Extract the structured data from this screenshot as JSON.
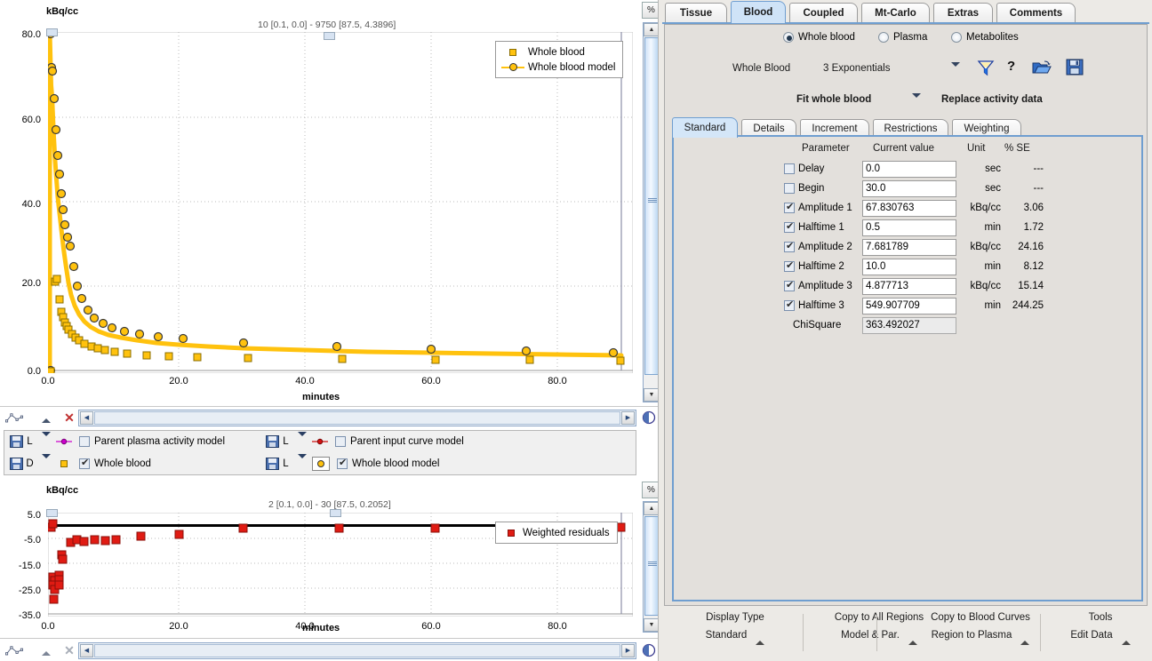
{
  "main_plot": {
    "y_unit": "kBq/cc",
    "title": "10 [0.1, 0.0] - 9750 [87.5, 4.3896]",
    "x_label": "minutes",
    "y_ticks": [
      "80.0",
      "60.0",
      "40.0",
      "20.0",
      "0.0"
    ],
    "x_ticks": [
      "0.0",
      "20.0",
      "40.0",
      "60.0",
      "80.0"
    ],
    "legend": [
      {
        "label": "Whole blood",
        "symbol": "square-marker",
        "color": "#FFC20E"
      },
      {
        "label": "Whole blood model",
        "symbol": "circle-line-marker",
        "color": "#FFC20E"
      }
    ],
    "percent_button": "%"
  },
  "resid_plot": {
    "y_unit": "kBq/cc",
    "title": "2 [0.1, 0.0] - 30 [87.5, 0.2052]",
    "x_label": "minutes",
    "y_ticks": [
      "5.0",
      "-5.0",
      "-15.0",
      "-25.0",
      "-35.0"
    ],
    "x_ticks": [
      "0.0",
      "20.0",
      "40.0",
      "60.0",
      "80.0"
    ],
    "legend": [
      {
        "label": "Weighted residuals",
        "symbol": "square-marker",
        "color": "#E01B13"
      }
    ],
    "percent_button": "%"
  },
  "chart_data": [
    {
      "type": "scatter",
      "id": "whole-blood-activity",
      "title": "10 [0.1, 0.0] - 9750 [87.5, 4.3896]",
      "xlabel": "minutes",
      "ylabel": "kBq/cc",
      "xlim": [
        0,
        91
      ],
      "ylim": [
        0,
        82
      ],
      "grid": true,
      "legend_position": "top-right",
      "series": [
        {
          "name": "Whole blood",
          "marker": "square",
          "color": "#FFC20E",
          "x": [
            0.1,
            0.35,
            0.6,
            0.85,
            1.1,
            1.35,
            1.6,
            1.85,
            2.1,
            2.6,
            3.1,
            3.6,
            4.5,
            5.5,
            6.5,
            7.5,
            9.0,
            11.0,
            14.0,
            17.5,
            22.0,
            30.0,
            45.0,
            60.0,
            75.0,
            87.5
          ],
          "y": [
            0.0,
            22.3,
            22.7,
            17.8,
            15.0,
            13.7,
            12.5,
            11.6,
            10.8,
            9.8,
            9.0,
            8.3,
            7.6,
            7.0,
            6.6,
            6.2,
            5.8,
            5.4,
            5.1,
            4.9,
            4.7,
            4.6,
            4.5,
            4.4,
            4.4,
            4.3896
          ]
        },
        {
          "name": "Whole blood model",
          "marker": "circle-line",
          "color": "#FFC20E",
          "x": [
            0.1,
            0.3,
            0.5,
            0.7,
            0.9,
            1.1,
            1.3,
            1.5,
            1.7,
            1.9,
            2.1,
            2.4,
            2.7,
            3.1,
            3.6,
            4.2,
            5.0,
            6.0,
            7.2,
            8.6,
            10.5,
            13.0,
            16.0,
            20.0,
            30.0,
            45.0,
            60.0,
            75.0,
            87.5
          ],
          "y": [
            0.0,
            80.0,
            72.0,
            71.5,
            64.5,
            57.0,
            51.0,
            46.5,
            42.0,
            38.0,
            34.5,
            31.5,
            29.5,
            24.5,
            20.0,
            17.0,
            14.3,
            12.5,
            11.2,
            10.2,
            9.4,
            8.6,
            8.0,
            7.5,
            6.6,
            5.8,
            5.3,
            4.9,
            4.6
          ]
        }
      ]
    },
    {
      "type": "scatter",
      "id": "weighted-residuals",
      "title": "2 [0.1, 0.0] - 30 [87.5, 0.2052]",
      "xlabel": "minutes",
      "ylabel": "kBq/cc",
      "xlim": [
        0,
        91
      ],
      "ylim": [
        -35,
        5
      ],
      "grid": true,
      "legend_position": "right",
      "series": [
        {
          "name": "Weighted residuals",
          "marker": "square",
          "color": "#E01B13",
          "x": [
            0.1,
            0.45,
            0.6,
            0.75,
            0.9,
            1.05,
            1.2,
            1.4,
            1.6,
            1.8,
            2.2,
            2.6,
            3.3,
            4.5,
            5.6,
            7.0,
            8.5,
            10.0,
            14.5,
            20.0,
            30.0,
            45.0,
            60.0,
            87.5
          ],
          "y": [
            0.2,
            1.5,
            -25.0,
            -26.5,
            -28.0,
            -29.5,
            -33.5,
            -24.5,
            -25.5,
            -27.5,
            -15.0,
            -16.5,
            -7.5,
            -6.5,
            -6.0,
            -5.5,
            -5.2,
            -5.0,
            -4.2,
            -3.8,
            -1.5,
            -1.4,
            -1.3,
            0.2052
          ]
        }
      ],
      "zero_line": 0
    }
  ],
  "curve_toolbar": {
    "icons": [
      "curve-icon",
      "triangle-up-icon",
      "close-x-icon"
    ],
    "scroll_left": "◀",
    "scroll_right": "▶"
  },
  "curve_list": [
    {
      "save": "disk-icon",
      "mode": "L",
      "symbol": "magenta-circle-marker",
      "checked": false,
      "label": "Parent plasma activity model",
      "color": "#CC00CC"
    },
    {
      "save": "disk-icon",
      "mode": "L",
      "symbol": "red-circle-marker",
      "checked": false,
      "label": "Parent input curve model",
      "color": "#D01010"
    },
    {
      "save": "disk-icon",
      "mode": "D",
      "symbol": "yellow-square-marker",
      "checked": true,
      "label": "Whole blood",
      "color": "#FFC20E"
    },
    {
      "save": "disk-icon",
      "mode": "L",
      "symbol": "yellow-circle-marker",
      "checked": true,
      "label": "Whole blood model",
      "color": "#FFC20E"
    }
  ],
  "right_panel": {
    "tabs": [
      {
        "label": "Tissue",
        "active": false
      },
      {
        "label": "Blood",
        "active": true
      },
      {
        "label": "Coupled",
        "active": false
      },
      {
        "label": "Mt-Carlo",
        "active": false
      },
      {
        "label": "Extras",
        "active": false
      },
      {
        "label": "Comments",
        "active": false
      }
    ],
    "blood_type_options": [
      {
        "label": "Whole blood",
        "selected": true
      },
      {
        "label": "Plasma",
        "selected": false
      },
      {
        "label": "Metabolites",
        "selected": false
      }
    ],
    "model_row": {
      "source_label": "Whole Blood",
      "model_name": "3 Exponentials",
      "dropdown_icon": "chevron-down-icon",
      "filter_icon": "funnel-icon",
      "help_icon": "question-mark-icon",
      "open_icon": "open-folder-icon",
      "save_icon": "save-disk-icon"
    },
    "fit_row": {
      "fit_target": "Fit whole blood",
      "dropdown_icon": "chevron-down-icon",
      "action_label": "Replace activity data"
    },
    "sub_tabs": [
      {
        "label": "Standard",
        "active": true
      },
      {
        "label": "Details",
        "active": false
      },
      {
        "label": "Increment",
        "active": false
      },
      {
        "label": "Restrictions",
        "active": false
      },
      {
        "label": "Weighting",
        "active": false
      }
    ],
    "param_table": {
      "headers": {
        "parameter": "Parameter",
        "value": "Current value",
        "unit": "Unit",
        "se": "% SE"
      },
      "rows": [
        {
          "checkbox": true,
          "checked": false,
          "name": "Delay",
          "value": "0.0",
          "unit": "sec",
          "se": "---"
        },
        {
          "checkbox": true,
          "checked": false,
          "name": "Begin",
          "value": "30.0",
          "unit": "sec",
          "se": "---"
        },
        {
          "checkbox": true,
          "checked": true,
          "name": "Amplitude 1",
          "value": "67.830763",
          "unit": "kBq/cc",
          "se": "3.06"
        },
        {
          "checkbox": true,
          "checked": true,
          "name": "Halftime 1",
          "value": "0.5",
          "unit": "min",
          "se": "1.72"
        },
        {
          "checkbox": true,
          "checked": true,
          "name": "Amplitude 2",
          "value": "7.681789",
          "unit": "kBq/cc",
          "se": "24.16"
        },
        {
          "checkbox": true,
          "checked": true,
          "name": "Halftime 2",
          "value": "10.0",
          "unit": "min",
          "se": "8.12"
        },
        {
          "checkbox": true,
          "checked": true,
          "name": "Amplitude 3",
          "value": "4.877713",
          "unit": "kBq/cc",
          "se": "15.14"
        },
        {
          "checkbox": true,
          "checked": true,
          "name": "Halftime 3",
          "value": "549.907709",
          "unit": "min",
          "se": "244.25"
        },
        {
          "checkbox": false,
          "checked": false,
          "name": "ChiSquare",
          "value": "363.492027",
          "unit": "",
          "se": "",
          "readonly": true
        }
      ]
    },
    "bottom_bar": [
      {
        "title": "Display Type",
        "value": "Standard",
        "arrow": "triangle-up-icon"
      },
      {
        "title": "Copy to All Regions",
        "value": "Model & Par.",
        "arrow": "triangle-up-icon"
      },
      {
        "title": "Copy to Blood Curves",
        "value": "Region to Plasma",
        "arrow": "triangle-up-icon"
      },
      {
        "title": "Tools",
        "value": "Edit Data",
        "arrow": "triangle-up-icon"
      }
    ]
  }
}
